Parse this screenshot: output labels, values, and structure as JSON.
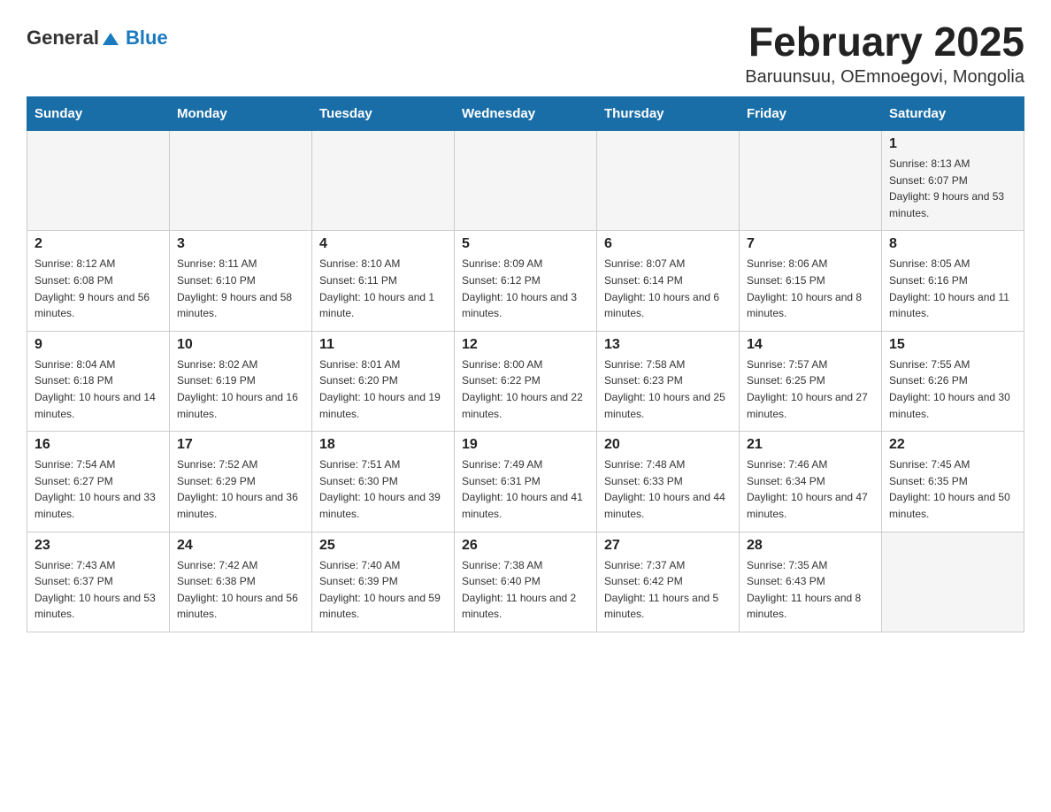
{
  "header": {
    "logo": {
      "text_general": "General",
      "text_blue": "Blue"
    },
    "title": "February 2025",
    "location": "Baruunsuu, OEmnoegovi, Mongolia"
  },
  "calendar": {
    "days_of_week": [
      "Sunday",
      "Monday",
      "Tuesday",
      "Wednesday",
      "Thursday",
      "Friday",
      "Saturday"
    ],
    "weeks": [
      [
        {
          "day": "",
          "info": ""
        },
        {
          "day": "",
          "info": ""
        },
        {
          "day": "",
          "info": ""
        },
        {
          "day": "",
          "info": ""
        },
        {
          "day": "",
          "info": ""
        },
        {
          "day": "",
          "info": ""
        },
        {
          "day": "1",
          "info": "Sunrise: 8:13 AM\nSunset: 6:07 PM\nDaylight: 9 hours and 53 minutes."
        }
      ],
      [
        {
          "day": "2",
          "info": "Sunrise: 8:12 AM\nSunset: 6:08 PM\nDaylight: 9 hours and 56 minutes."
        },
        {
          "day": "3",
          "info": "Sunrise: 8:11 AM\nSunset: 6:10 PM\nDaylight: 9 hours and 58 minutes."
        },
        {
          "day": "4",
          "info": "Sunrise: 8:10 AM\nSunset: 6:11 PM\nDaylight: 10 hours and 1 minute."
        },
        {
          "day": "5",
          "info": "Sunrise: 8:09 AM\nSunset: 6:12 PM\nDaylight: 10 hours and 3 minutes."
        },
        {
          "day": "6",
          "info": "Sunrise: 8:07 AM\nSunset: 6:14 PM\nDaylight: 10 hours and 6 minutes."
        },
        {
          "day": "7",
          "info": "Sunrise: 8:06 AM\nSunset: 6:15 PM\nDaylight: 10 hours and 8 minutes."
        },
        {
          "day": "8",
          "info": "Sunrise: 8:05 AM\nSunset: 6:16 PM\nDaylight: 10 hours and 11 minutes."
        }
      ],
      [
        {
          "day": "9",
          "info": "Sunrise: 8:04 AM\nSunset: 6:18 PM\nDaylight: 10 hours and 14 minutes."
        },
        {
          "day": "10",
          "info": "Sunrise: 8:02 AM\nSunset: 6:19 PM\nDaylight: 10 hours and 16 minutes."
        },
        {
          "day": "11",
          "info": "Sunrise: 8:01 AM\nSunset: 6:20 PM\nDaylight: 10 hours and 19 minutes."
        },
        {
          "day": "12",
          "info": "Sunrise: 8:00 AM\nSunset: 6:22 PM\nDaylight: 10 hours and 22 minutes."
        },
        {
          "day": "13",
          "info": "Sunrise: 7:58 AM\nSunset: 6:23 PM\nDaylight: 10 hours and 25 minutes."
        },
        {
          "day": "14",
          "info": "Sunrise: 7:57 AM\nSunset: 6:25 PM\nDaylight: 10 hours and 27 minutes."
        },
        {
          "day": "15",
          "info": "Sunrise: 7:55 AM\nSunset: 6:26 PM\nDaylight: 10 hours and 30 minutes."
        }
      ],
      [
        {
          "day": "16",
          "info": "Sunrise: 7:54 AM\nSunset: 6:27 PM\nDaylight: 10 hours and 33 minutes."
        },
        {
          "day": "17",
          "info": "Sunrise: 7:52 AM\nSunset: 6:29 PM\nDaylight: 10 hours and 36 minutes."
        },
        {
          "day": "18",
          "info": "Sunrise: 7:51 AM\nSunset: 6:30 PM\nDaylight: 10 hours and 39 minutes."
        },
        {
          "day": "19",
          "info": "Sunrise: 7:49 AM\nSunset: 6:31 PM\nDaylight: 10 hours and 41 minutes."
        },
        {
          "day": "20",
          "info": "Sunrise: 7:48 AM\nSunset: 6:33 PM\nDaylight: 10 hours and 44 minutes."
        },
        {
          "day": "21",
          "info": "Sunrise: 7:46 AM\nSunset: 6:34 PM\nDaylight: 10 hours and 47 minutes."
        },
        {
          "day": "22",
          "info": "Sunrise: 7:45 AM\nSunset: 6:35 PM\nDaylight: 10 hours and 50 minutes."
        }
      ],
      [
        {
          "day": "23",
          "info": "Sunrise: 7:43 AM\nSunset: 6:37 PM\nDaylight: 10 hours and 53 minutes."
        },
        {
          "day": "24",
          "info": "Sunrise: 7:42 AM\nSunset: 6:38 PM\nDaylight: 10 hours and 56 minutes."
        },
        {
          "day": "25",
          "info": "Sunrise: 7:40 AM\nSunset: 6:39 PM\nDaylight: 10 hours and 59 minutes."
        },
        {
          "day": "26",
          "info": "Sunrise: 7:38 AM\nSunset: 6:40 PM\nDaylight: 11 hours and 2 minutes."
        },
        {
          "day": "27",
          "info": "Sunrise: 7:37 AM\nSunset: 6:42 PM\nDaylight: 11 hours and 5 minutes."
        },
        {
          "day": "28",
          "info": "Sunrise: 7:35 AM\nSunset: 6:43 PM\nDaylight: 11 hours and 8 minutes."
        },
        {
          "day": "",
          "info": ""
        }
      ]
    ]
  }
}
